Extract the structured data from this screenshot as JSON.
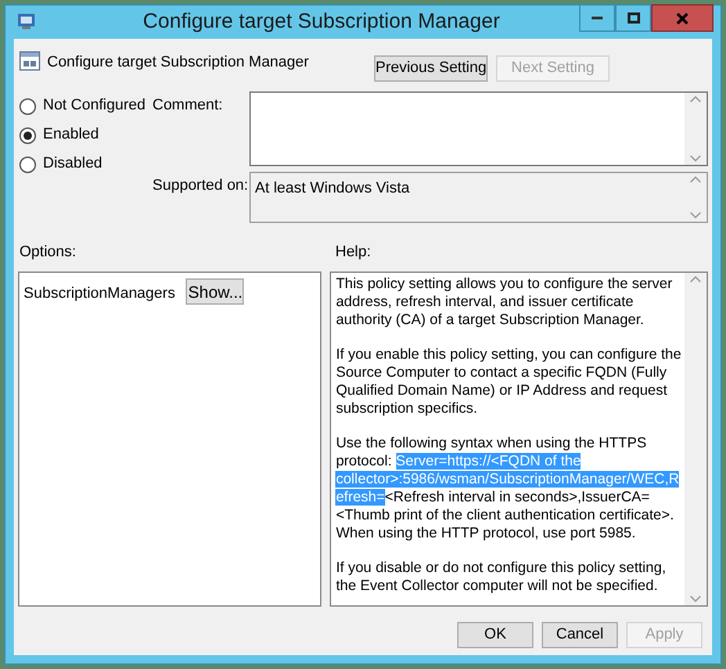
{
  "window": {
    "title": "Configure target Subscription Manager"
  },
  "header": {
    "title": "Configure target Subscription Manager"
  },
  "nav_buttons": [
    {
      "label": "Previous Setting",
      "disabled": false
    },
    {
      "label": "Next Setting",
      "disabled": true
    }
  ],
  "state_options": [
    {
      "label": "Not Configured",
      "selected": false
    },
    {
      "label": "Enabled",
      "selected": true
    },
    {
      "label": "Disabled",
      "selected": false
    }
  ],
  "comment": {
    "label": "Comment:"
  },
  "supported_on": {
    "label": "Supported on:",
    "value": "At least Windows Vista"
  },
  "options": {
    "label": "Options:",
    "item_label": "SubscriptionManagers",
    "button": "Show..."
  },
  "help": {
    "label": "Help:",
    "paragraphs": [
      [
        {
          "text": "This policy setting allows you to configure the server address, refresh interval, and issuer certificate authority (CA) of a target Subscription Manager.",
          "highlighted": false
        }
      ],
      [
        {
          "text": "If you enable this policy setting, you can configure the Source Computer to contact a specific FQDN (Fully Qualified Domain Name) or IP Address and request subscription specifics.",
          "highlighted": false
        }
      ],
      [
        {
          "text": "Use the following syntax when using the HTTPS protocol: ",
          "highlighted": false
        },
        {
          "text": "Server=https://<FQDN of the collector>:5986/wsman/SubscriptionManager/WEC,Refresh=",
          "highlighted": true
        },
        {
          "text": "<Refresh interval in seconds>,IssuerCA=<Thumb print of the client authentication certificate>. When using the HTTP protocol, use port 5985.",
          "highlighted": false
        }
      ],
      [
        {
          "text": "If you disable or do not configure this policy setting, the Event Collector computer will not be specified.",
          "highlighted": false
        }
      ]
    ]
  },
  "buttons": [
    {
      "label": "OK",
      "disabled": false
    },
    {
      "label": "Cancel",
      "disabled": false
    },
    {
      "label": "Apply",
      "disabled": true
    }
  ]
}
